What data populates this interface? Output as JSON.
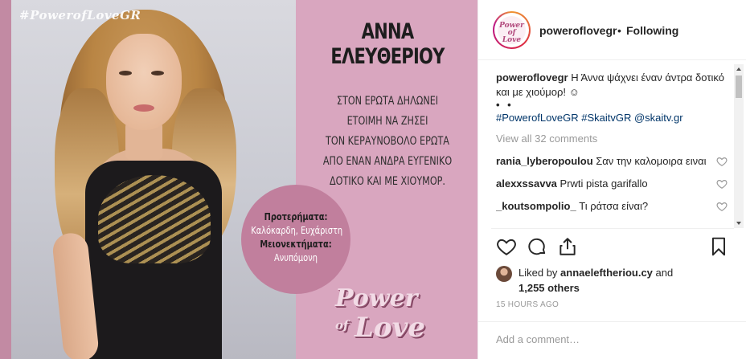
{
  "post_image": {
    "hashtag": "#PowerofLoveGR",
    "name_line1": "ΑΝΝΑ",
    "name_line2": "ΕΛΕΥΘΕΡΙΟΥ",
    "description_lines": [
      "ΣΤΟΝ ΕΡΩΤΑ ΔΗΛΩΝΕΙ",
      "ΕΤΟΙΜΗ ΝΑ ΖΗΣΕΙ",
      "ΤΟΝ ΚΕΡΑΥΝΟΒΟΛΟ ΕΡΩΤΑ",
      "ΑΠΟ ΕΝΑΝ ΑΝΔΡΑ ΕΥΓΕΝΙΚΟ",
      "ΔΟΤΙΚΟ ΚΑΙ ΜΕ ΧΙΟΥΜΟΡ."
    ],
    "pros_label": "Προτερήματα:",
    "pros_value_1": "Καλόκαρδη, Ευχάριστη",
    "cons_label": "Μειονεκτήματα:",
    "cons_value": "Ανυπόμονη",
    "logo_word1": "Power",
    "logo_word2": "of",
    "logo_word3": "Love"
  },
  "header": {
    "avatar_text": "Power of Love",
    "username": "poweroflovegr",
    "separator": "•",
    "follow_status": "Following"
  },
  "caption": {
    "username": "poweroflovegr",
    "text": " Η Άννα ψάχνει έναν άντρα δοτικό και με χιούμορ! ☺",
    "dots": "• •",
    "hashtags": "#PowerofLoveGR #SkaitvGR @skaitv.gr"
  },
  "view_all": "View all 32 comments",
  "comments": [
    {
      "username": "rania_lyberopoulou",
      "text": " Σαν την καλομοιρα ειναι"
    },
    {
      "username": "alexxssavva",
      "text": " Prwti pista garifallo"
    },
    {
      "username": "_koutsompolio_",
      "text": " Τι ράτσα είναι?"
    }
  ],
  "actions": {
    "like_icon": "heart-icon",
    "comment_icon": "comment-icon",
    "share_icon": "share-icon",
    "save_icon": "bookmark-icon"
  },
  "likes": {
    "prefix": "Liked by ",
    "user": "annaeleftheriou.cy",
    "middle": " and",
    "count": "1,255 others"
  },
  "timestamp": "15 HOURS AGO",
  "add_comment_placeholder": "Add a comment…",
  "colors": {
    "link": "#003569",
    "muted": "#999999",
    "text": "#262626",
    "image_pink": "#d9a6bf",
    "badge_pink": "#c17f9d"
  }
}
